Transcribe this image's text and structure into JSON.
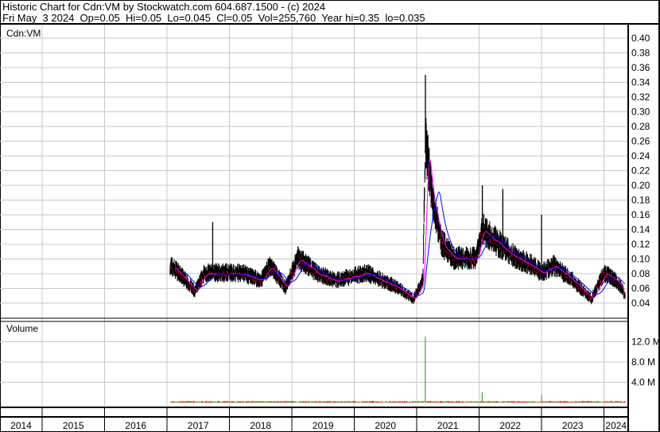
{
  "header": {
    "title": "Historic Chart for Cdn:VM by Stockwatch.com 604.687.1500 - (c) 2024",
    "quote": "Fri May  3 2024  Op=0.05  Hi=0.05  Lo=0.045  Cl=0.05  Vol=255,760  Year hi=0.35  lo=0.035"
  },
  "chart_data": {
    "type": "line",
    "title": "Cdn:VM",
    "volume_label": "Volume",
    "price_ticks": [
      "0.40",
      "0.38",
      "0.36",
      "0.34",
      "0.32",
      "0.30",
      "0.28",
      "0.26",
      "0.24",
      "0.22",
      "0.20",
      "0.18",
      "0.16",
      "0.14",
      "0.12",
      "0.10",
      "0.08",
      "0.06",
      "0.04"
    ],
    "price_range": [
      0.025,
      0.41
    ],
    "volume_ticks": [
      "12.0 M",
      "8.0 M",
      "4.0 M"
    ],
    "volume_range_millions": [
      0,
      14.5
    ],
    "years": [
      "2014",
      "2015",
      "2016",
      "2017",
      "2018",
      "2019",
      "2020",
      "2021",
      "2022",
      "2023",
      "2024"
    ],
    "price_keypoints": [
      [
        2017.05,
        0.09
      ],
      [
        2017.2,
        0.08
      ],
      [
        2017.45,
        0.055
      ],
      [
        2017.6,
        0.08
      ],
      [
        2017.9,
        0.08
      ],
      [
        2018.2,
        0.08
      ],
      [
        2018.5,
        0.07
      ],
      [
        2018.65,
        0.09
      ],
      [
        2018.9,
        0.06
      ],
      [
        2019.1,
        0.1
      ],
      [
        2019.4,
        0.08
      ],
      [
        2019.7,
        0.07
      ],
      [
        2019.95,
        0.075
      ],
      [
        2020.2,
        0.08
      ],
      [
        2020.45,
        0.07
      ],
      [
        2020.7,
        0.06
      ],
      [
        2020.95,
        0.045
      ],
      [
        2021.1,
        0.07
      ],
      [
        2021.14,
        0.26
      ],
      [
        2021.25,
        0.18
      ],
      [
        2021.4,
        0.12
      ],
      [
        2021.6,
        0.1
      ],
      [
        2021.95,
        0.1
      ],
      [
        2022.05,
        0.14
      ],
      [
        2022.3,
        0.12
      ],
      [
        2022.6,
        0.1
      ],
      [
        2022.85,
        0.09
      ],
      [
        2023.0,
        0.08
      ],
      [
        2023.2,
        0.09
      ],
      [
        2023.5,
        0.07
      ],
      [
        2023.8,
        0.045
      ],
      [
        2024.0,
        0.08
      ],
      [
        2024.2,
        0.07
      ],
      [
        2024.34,
        0.05
      ]
    ],
    "price_spikes": [
      [
        2017.73,
        0.15
      ],
      [
        2021.14,
        0.35
      ],
      [
        2022.05,
        0.2
      ],
      [
        2022.38,
        0.195
      ],
      [
        2023.0,
        0.16
      ]
    ],
    "volume_spikes_millions": [
      [
        2021.14,
        13.0
      ],
      [
        2022.05,
        2.0
      ],
      [
        2023.0,
        1.5
      ]
    ],
    "colors": {
      "bars": "#000000",
      "ma_short": "#ff00ff",
      "ma_long": "#0000ff",
      "dots": "#ff0000",
      "vol_up": "#33aa33",
      "vol_down": "#ff0000",
      "grid": "#c8c8c8"
    }
  }
}
